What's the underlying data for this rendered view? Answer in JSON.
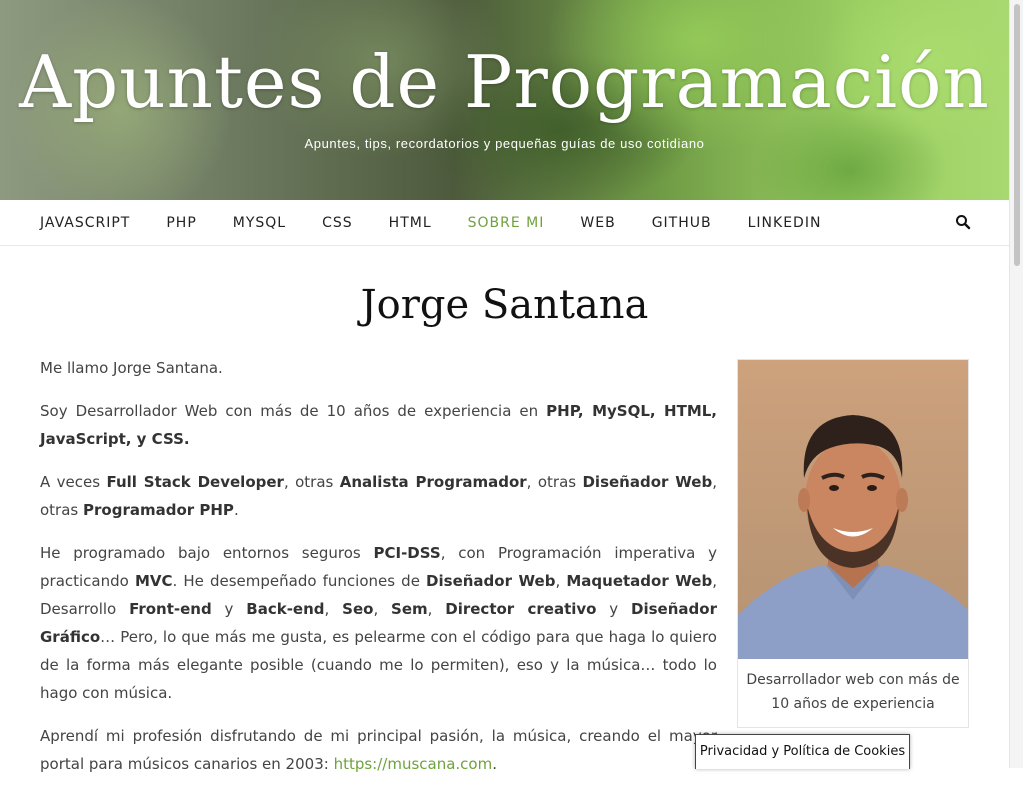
{
  "header": {
    "site_title": "Apuntes de Programación",
    "tagline": "Apuntes, tips, recordatorios y pequeñas guías de uso cotidiano"
  },
  "nav": {
    "items": [
      {
        "label": "JAVASCRIPT",
        "active": false
      },
      {
        "label": "PHP",
        "active": false
      },
      {
        "label": "MYSQL",
        "active": false
      },
      {
        "label": "CSS",
        "active": false
      },
      {
        "label": "HTML",
        "active": false
      },
      {
        "label": "SOBRE MI",
        "active": true
      },
      {
        "label": "WEB",
        "active": false
      },
      {
        "label": "GITHUB",
        "active": false
      },
      {
        "label": "LINKEDIN",
        "active": false
      }
    ],
    "search_icon": "search-icon"
  },
  "page": {
    "title": "Jorge Santana",
    "p1": "Me llamo Jorge Santana.",
    "p2": {
      "text": "Soy Desarrollador Web con más de 10 años de experiencia en ",
      "bold": "PHP, MySQL, HTML, JavaScript, y CSS."
    },
    "p3": {
      "a": "A veces ",
      "b1": "Full Stack Developer",
      "c": ", otras ",
      "b2": "Analista Programador",
      "d": ", otras ",
      "b3": "Diseñador Web",
      "e": ", otras ",
      "b4": "Programador PHP",
      "f": "."
    },
    "p4": {
      "a": "He programado bajo entornos seguros ",
      "b1": "PCI-DSS",
      "c": ", con Programación imperativa y practicando ",
      "b2": "MVC",
      "d": ". He desempeñado funciones de ",
      "b3": "Diseñador Web",
      "e": ", ",
      "b4": "Maquetador Web",
      "f": ", Desarrollo ",
      "b5": "Front-end",
      "g": " y ",
      "b6": "Back-end",
      "h": ", ",
      "b7": "Seo",
      "i": ", ",
      "b8": "Sem",
      "j": ", ",
      "b9": "Director creativo",
      "k": " y ",
      "b10": "Diseñador Gráfico",
      "l": "… Pero, lo que más me gusta, es pelearme con el código para que haga lo quiero de la forma más elegante posible (cuando me lo permiten), eso y la música… todo lo hago con música."
    },
    "p5": {
      "text": "Aprendí mi profesión disfrutando de mi principal pasión, la música, creando el mayor portal para músicos canarios en 2003: ",
      "link": "https://muscana.com",
      "after": "."
    },
    "figure_caption": "Desarrollador web con más de 10 años de experiencia"
  },
  "cookie": {
    "label": "Privacidad y Política de Cookies"
  },
  "colors": {
    "accent": "#6fa23c",
    "text": "#444444",
    "title": "#111111"
  }
}
